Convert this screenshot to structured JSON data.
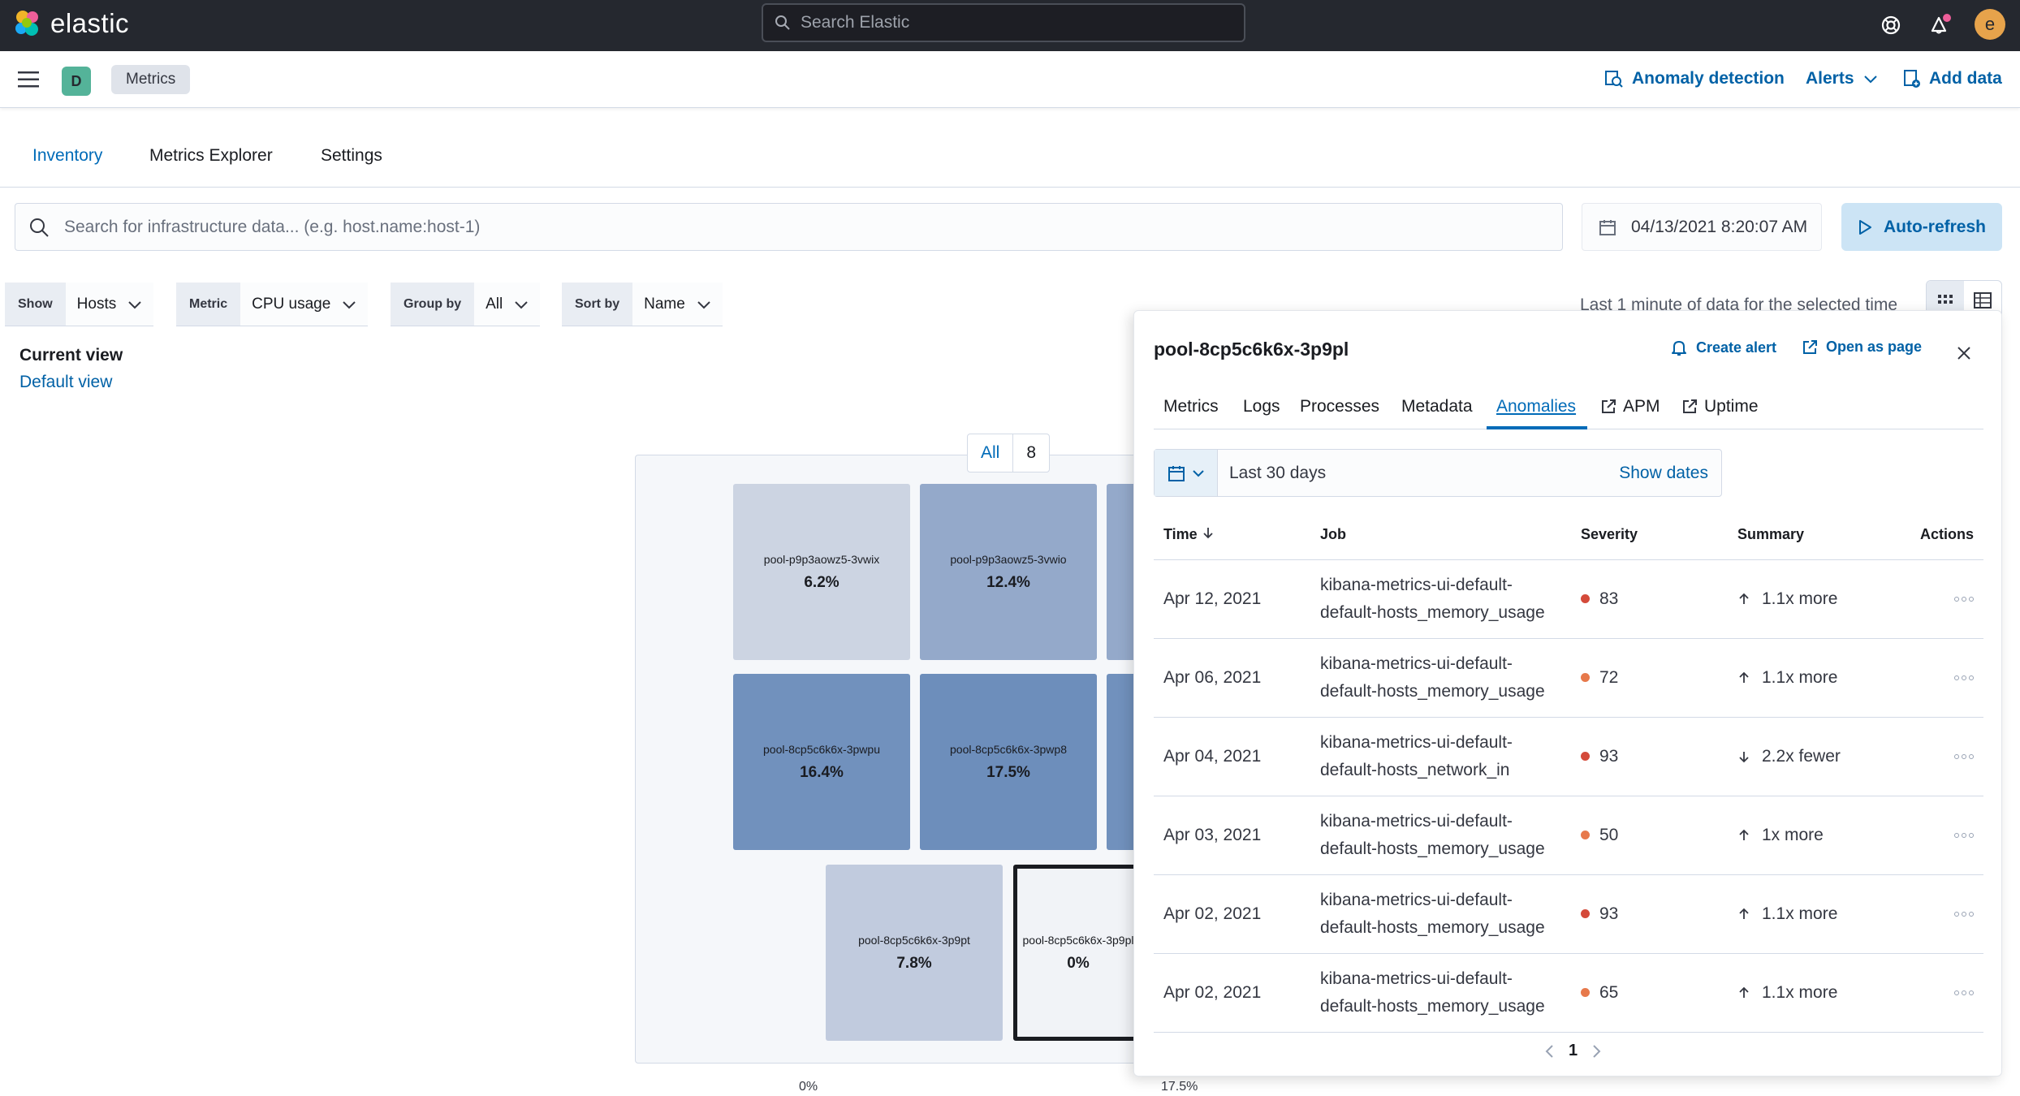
{
  "topbar": {
    "brand": "elastic",
    "search_placeholder": "Search Elastic",
    "user_initial": "e"
  },
  "subbar": {
    "space_initial": "D",
    "breadcrumb": "Metrics",
    "anomaly_detection": "Anomaly detection",
    "alerts": "Alerts",
    "add_data": "Add data"
  },
  "tabs": [
    "Inventory",
    "Metrics Explorer",
    "Settings"
  ],
  "infra_search_placeholder": "Search for infrastructure data... (e.g. host.name:host-1)",
  "date": "04/13/2021 8:20:07 AM",
  "auto_refresh": "Auto-refresh",
  "filters": {
    "show_label": "Show",
    "show_value": "Hosts",
    "metric_label": "Metric",
    "metric_value": "CPU usage",
    "group_label": "Group by",
    "group_value": "All",
    "sort_label": "Sort by",
    "sort_value": "Name"
  },
  "current_view": {
    "title": "Current view",
    "link": "Default view"
  },
  "data_note": "Last 1 minute of data for the selected time",
  "map": {
    "badge_label": "All",
    "badge_count": "8",
    "nodes": [
      {
        "name": "pool-p9p3aowz5-3vwix",
        "value": "6.2%",
        "color": "#ccd4e2"
      },
      {
        "name": "pool-p9p3aowz5-3vwio",
        "value": "12.4%",
        "color": "#94a9ca"
      },
      {
        "name": "pool-8cp5c6k6x-3pwpu",
        "value": "16.4%",
        "color": "#7191bd"
      },
      {
        "name": "pool-8cp5c6k6x-3pwp8",
        "value": "17.5%",
        "color": "#6d8ebb"
      },
      {
        "name": "pool-8cp5c6k6x-3p9pt",
        "value": "7.8%",
        "color": "#c1cbde"
      },
      {
        "name": "pool-8cp5c6k6x-3p9pl",
        "value": "0%",
        "color": "#f1f3f7"
      }
    ],
    "legend_min": "0%",
    "legend_max": "17.5%"
  },
  "flyout": {
    "title": "pool-8cp5c6k6x-3p9pl",
    "create_alert": "Create alert",
    "open_as_page": "Open as page",
    "tabs": [
      "Metrics",
      "Logs",
      "Processes",
      "Metadata",
      "Anomalies",
      "APM",
      "Uptime"
    ],
    "range": "Last 30 days",
    "show_dates": "Show dates",
    "columns": [
      "Time",
      "Job",
      "Severity",
      "Summary",
      "Actions"
    ],
    "rows": [
      {
        "time": "Apr 12, 2021",
        "job1": "kibana-metrics-ui-default-",
        "job2": "default-hosts_memory_usage",
        "severity": "83",
        "sev_color": "#d44a3a",
        "dir": "up",
        "summary": "1.1x more"
      },
      {
        "time": "Apr 06, 2021",
        "job1": "kibana-metrics-ui-default-",
        "job2": "default-hosts_memory_usage",
        "severity": "72",
        "sev_color": "#e7794b",
        "dir": "up",
        "summary": "1.1x more"
      },
      {
        "time": "Apr 04, 2021",
        "job1": "kibana-metrics-ui-default-",
        "job2": "default-hosts_network_in",
        "severity": "93",
        "sev_color": "#d44a3a",
        "dir": "down",
        "summary": "2.2x fewer"
      },
      {
        "time": "Apr 03, 2021",
        "job1": "kibana-metrics-ui-default-",
        "job2": "default-hosts_memory_usage",
        "severity": "50",
        "sev_color": "#e7794b",
        "dir": "up",
        "summary": "1x more"
      },
      {
        "time": "Apr 02, 2021",
        "job1": "kibana-metrics-ui-default-",
        "job2": "default-hosts_memory_usage",
        "severity": "93",
        "sev_color": "#d44a3a",
        "dir": "up",
        "summary": "1.1x more"
      },
      {
        "time": "Apr 02, 2021",
        "job1": "kibana-metrics-ui-default-",
        "job2": "default-hosts_memory_usage",
        "severity": "65",
        "sev_color": "#e7794b",
        "dir": "up",
        "summary": "1.1x more"
      }
    ],
    "page": "1"
  }
}
